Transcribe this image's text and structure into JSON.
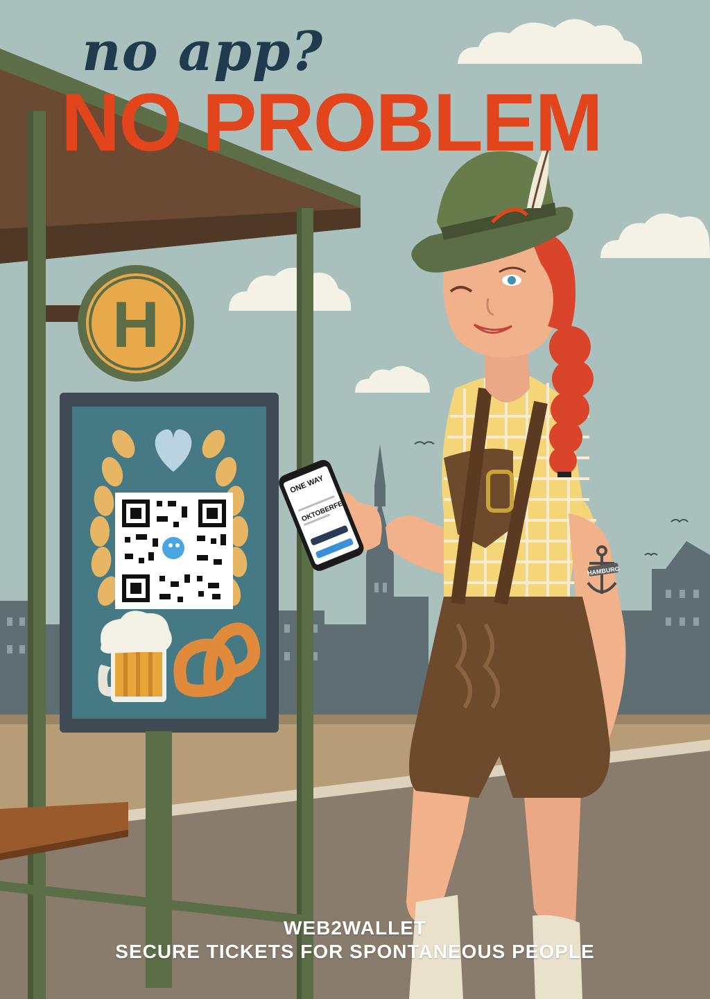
{
  "headline": {
    "small": "no app?",
    "large": "NO PROBLEM"
  },
  "sign": {
    "stop_letter": "H"
  },
  "phone": {
    "line1": "ONE WAY",
    "line2": "OKTOBERFE"
  },
  "tattoo": {
    "text": "HAMBURG"
  },
  "footer": {
    "brand": "WEB2WALLET",
    "slogan": "SECURE TICKETS FOR SPONTANEOUS PEOPLE"
  },
  "colors": {
    "sky": "#a9c0bd",
    "headline_orange": "#e2451c",
    "headline_navy": "#1f3b4d",
    "shelter_green": "#5b6e47",
    "lederhosen_brown": "#6e4a2c",
    "hair_red": "#d9442a"
  }
}
